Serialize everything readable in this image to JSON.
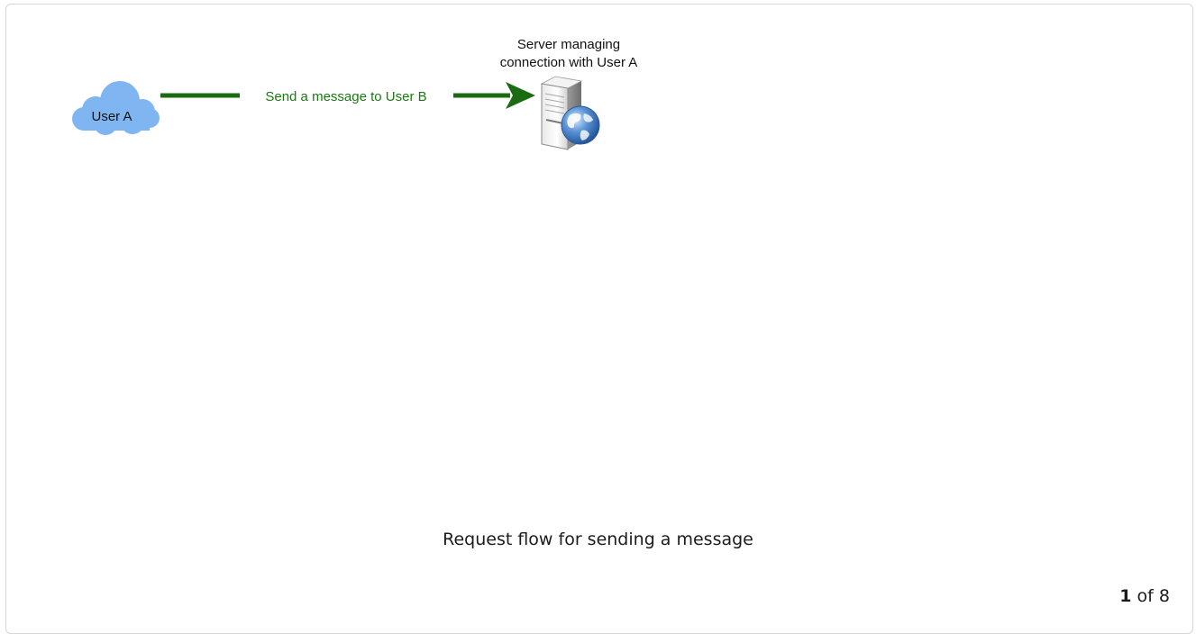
{
  "diagram": {
    "cloud_label": "User A",
    "server_label_line1": "Server managing",
    "server_label_line2": "connection with User A",
    "edge_label": "Send a message to User B",
    "colors": {
      "cloud_fill": "#7fb6f2",
      "arrow": "#1a6b12",
      "edge_label": "#1a7a12"
    }
  },
  "caption": "Request flow for sending a message",
  "pager": {
    "current": "1",
    "of_word": "of",
    "total": "8"
  }
}
